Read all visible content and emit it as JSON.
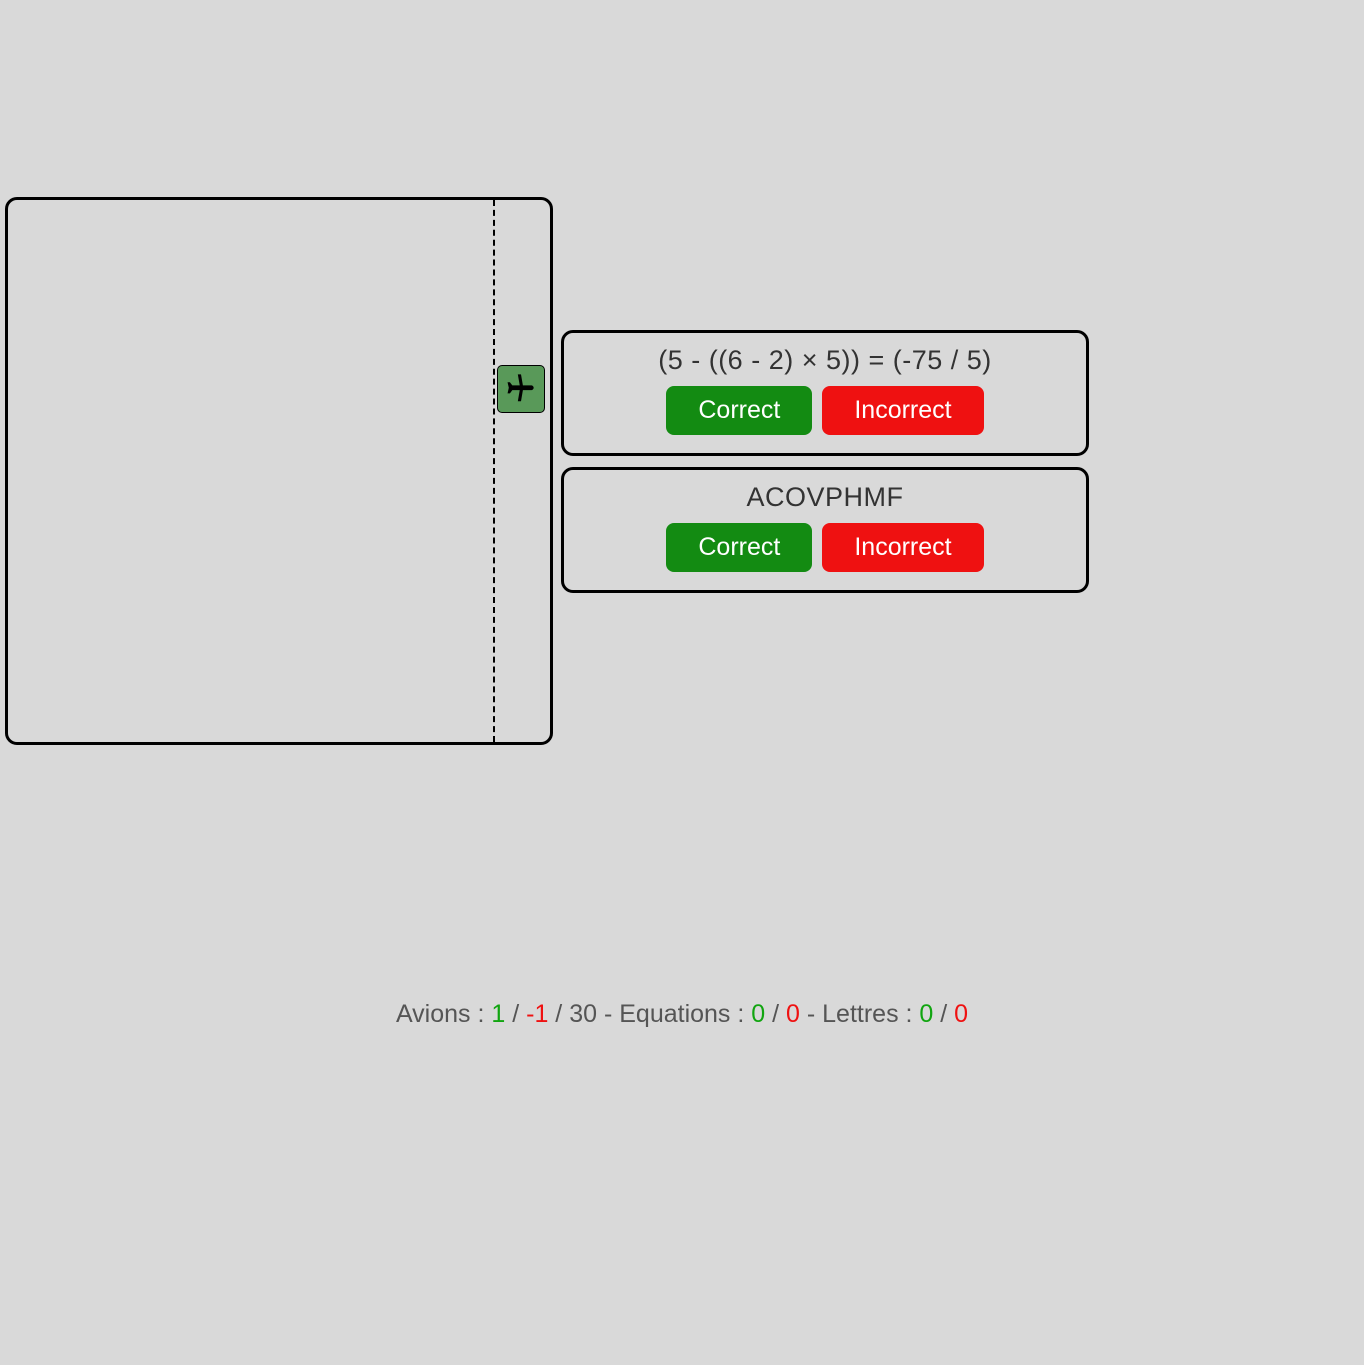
{
  "equation": {
    "prompt": "(5 - ((6 - 2) × 5)) = (-75 / 5)",
    "correct_label": "Correct",
    "incorrect_label": "Incorrect"
  },
  "letters": {
    "prompt": "ACOVPHMF",
    "correct_label": "Correct",
    "incorrect_label": "Incorrect"
  },
  "score": {
    "avions_label": "Avions : ",
    "avions_good": "1",
    "avions_sep1": " / ",
    "avions_bad": "-1",
    "avions_rest": " / 30 - ",
    "eq_label": "Equations : ",
    "eq_good": "0",
    "eq_sep": " / ",
    "eq_bad": "0",
    "mid_sep": " - ",
    "le_label": "Lettres : ",
    "le_good": "0",
    "le_sep": " / ",
    "le_bad": "0"
  },
  "icons": {
    "plane": "airplane-icon"
  }
}
